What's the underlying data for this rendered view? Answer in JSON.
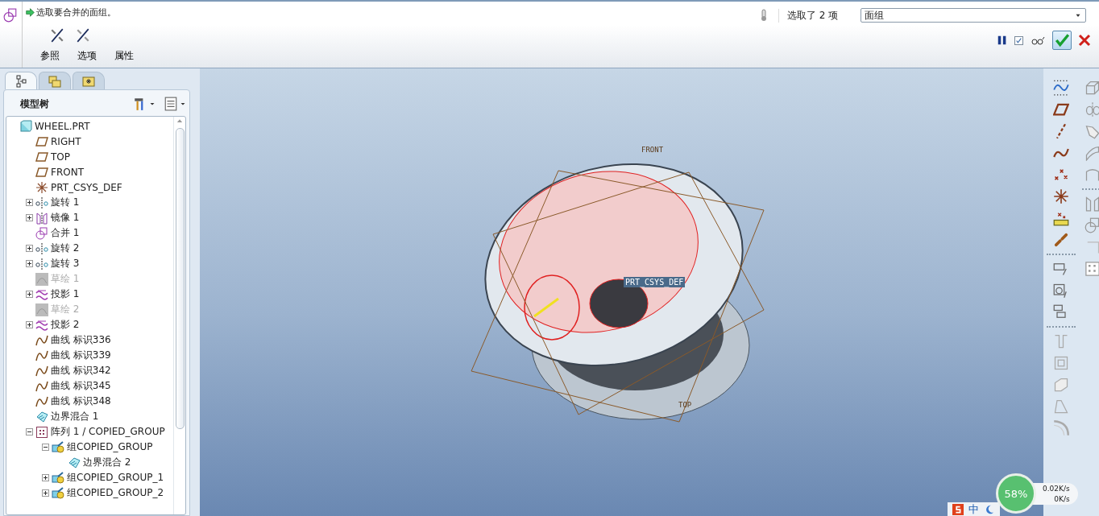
{
  "toolbar": {
    "prompt": "选取要合并的面组。",
    "panel_tabs": [
      "参照",
      "选项",
      "属性"
    ],
    "selection_count": "选取了 2 项",
    "filter": {
      "value": "面组"
    },
    "preview_checkbox": {
      "checked": true
    }
  },
  "navigator": {
    "tabs": [
      {
        "selected": true
      },
      {
        "selected": false
      },
      {
        "selected": false
      }
    ],
    "title": "模型树",
    "tree": [
      {
        "label": "WHEEL.PRT",
        "kind": "part",
        "disabled": false,
        "children": [
          {
            "label": "RIGHT",
            "kind": "plane",
            "disabled": false
          },
          {
            "label": "TOP",
            "kind": "plane",
            "disabled": false
          },
          {
            "label": "FRONT",
            "kind": "plane",
            "disabled": false
          },
          {
            "label": "PRT_CSYS_DEF",
            "kind": "csys",
            "disabled": false
          },
          {
            "label": "旋转 1",
            "kind": "revolve",
            "disabled": false,
            "expanded": false
          },
          {
            "label": "镜像 1",
            "kind": "mirror",
            "disabled": false,
            "expanded": false
          },
          {
            "label": "合并 1",
            "kind": "merge",
            "disabled": false
          },
          {
            "label": "旋转 2",
            "kind": "revolve",
            "disabled": false,
            "expanded": false
          },
          {
            "label": "旋转 3",
            "kind": "revolve",
            "disabled": false,
            "expanded": false
          },
          {
            "label": "草绘 1",
            "kind": "sketch",
            "disabled": true
          },
          {
            "label": "投影 1",
            "kind": "project",
            "disabled": false,
            "expanded": false
          },
          {
            "label": "草绘 2",
            "kind": "sketch",
            "disabled": true
          },
          {
            "label": "投影 2",
            "kind": "project",
            "disabled": false,
            "expanded": false
          },
          {
            "label": "曲线 标识336",
            "kind": "curve",
            "disabled": false
          },
          {
            "label": "曲线 标识339",
            "kind": "curve",
            "disabled": false
          },
          {
            "label": "曲线 标识342",
            "kind": "curve",
            "disabled": false
          },
          {
            "label": "曲线 标识345",
            "kind": "curve",
            "disabled": false
          },
          {
            "label": "曲线 标识348",
            "kind": "curve",
            "disabled": false
          },
          {
            "label": "边界混合 1",
            "kind": "boundary",
            "disabled": false
          },
          {
            "label": "阵列 1 / COPIED_GROUP",
            "kind": "pattern",
            "disabled": false,
            "expanded": true,
            "children": [
              {
                "label": "组COPIED_GROUP",
                "kind": "group",
                "disabled": false,
                "expanded": true,
                "children": [
                  {
                    "label": "边界混合 2",
                    "kind": "boundary",
                    "disabled": false
                  }
                ]
              },
              {
                "label": "组COPIED_GROUP_1",
                "kind": "group",
                "disabled": false,
                "expanded": false
              },
              {
                "label": "组COPIED_GROUP_2",
                "kind": "group",
                "disabled": false,
                "expanded": false
              }
            ]
          }
        ]
      }
    ]
  },
  "viewport": {
    "labels": [
      {
        "text": "FRONT",
        "kind": "plane"
      },
      {
        "text": "TOP",
        "kind": "plane"
      },
      {
        "text": "PRT_CSYS_DEF",
        "kind": "csys"
      }
    ]
  },
  "network_meter": {
    "percent": "58%",
    "upload": "0.02K/s",
    "download": "0K/s"
  },
  "ime_bar": {
    "mode": "中"
  }
}
